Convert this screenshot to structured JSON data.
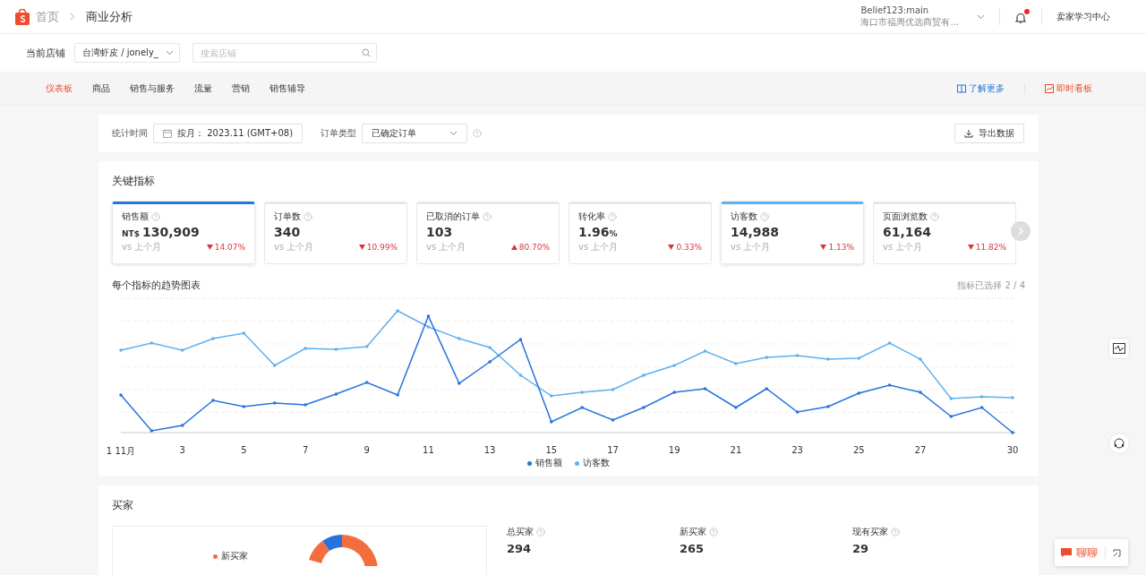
{
  "header": {
    "breadcrumb": [
      "首页",
      "商业分析"
    ],
    "account": {
      "name": "Belief123:main",
      "shop": "海口市福周优选商贸有..."
    },
    "notification_dot": true,
    "learning_link": "卖家学习中心"
  },
  "store_bar": {
    "label": "当前店铺",
    "store": "台湾虾皮 / jonely_",
    "search": {
      "placeholder": "搜索店铺"
    }
  },
  "nav": {
    "tabs": [
      {
        "label": "仪表板",
        "selected": true
      },
      {
        "label": "商品",
        "selected": false
      },
      {
        "label": "销售与服务",
        "selected": false
      },
      {
        "label": "流量",
        "selected": false
      },
      {
        "label": "营销",
        "selected": false
      },
      {
        "label": "销售辅导",
        "selected": false
      }
    ],
    "links": [
      {
        "label": "了解更多",
        "kind": "book"
      },
      {
        "label": "即时看板",
        "kind": "live"
      }
    ]
  },
  "filters": {
    "time_label": "统计时间",
    "time_value": "按月： 2023.11 (GMT+08)",
    "order_label": "订单类型",
    "order_value": "已确定订单",
    "export": "导出数据"
  },
  "key_metrics": {
    "title": "关键指标",
    "cards": [
      {
        "label": "销售额",
        "prefix": "NT$",
        "value": "130,909",
        "compare": "vs 上个月",
        "increased": false,
        "change": "14.07%",
        "selected": true,
        "color": "#2673dd"
      },
      {
        "label": "订单数",
        "value": "340",
        "compare": "vs 上个月",
        "increased": false,
        "change": "10.99%",
        "selected": false
      },
      {
        "label": "已取消的订单",
        "value": "103",
        "compare": "vs 上个月",
        "increased": true,
        "change": "80.70%",
        "selected": false
      },
      {
        "label": "转化率",
        "value": "1.96",
        "suffix": "%",
        "compare": "vs 上个月",
        "increased": false,
        "change": "0.33%",
        "selected": false
      },
      {
        "label": "访客数",
        "value": "14,988",
        "compare": "vs 上个月",
        "increased": false,
        "change": "1.13%",
        "selected": true,
        "color": "#5eb0ef"
      },
      {
        "label": "页面浏览数",
        "value": "61,164",
        "compare": "vs 上个月",
        "increased": false,
        "change": "11.82%",
        "selected": false
      }
    ],
    "trend_title": "每个指标的趋势图表",
    "selected_count": "指标已选择 2 / 4",
    "x_labels": [
      "1 11月",
      "3",
      "5",
      "7",
      "9",
      "11",
      "13",
      "15",
      "17",
      "19",
      "21",
      "23",
      "25",
      "27",
      "30"
    ],
    "legend": [
      {
        "label": "销售额",
        "color": "#2673dd"
      },
      {
        "label": "访客数",
        "color": "#5eb0ef"
      }
    ]
  },
  "buyers": {
    "title": "买家",
    "legend": [
      {
        "label": "新买家",
        "color": "#f36d3f"
      }
    ],
    "stats": [
      {
        "label": "总买家",
        "value": "294"
      },
      {
        "label": "新买家",
        "value": "265"
      },
      {
        "label": "现有买家",
        "value": "29"
      }
    ]
  },
  "chat": {
    "label": "聊聊"
  }
}
